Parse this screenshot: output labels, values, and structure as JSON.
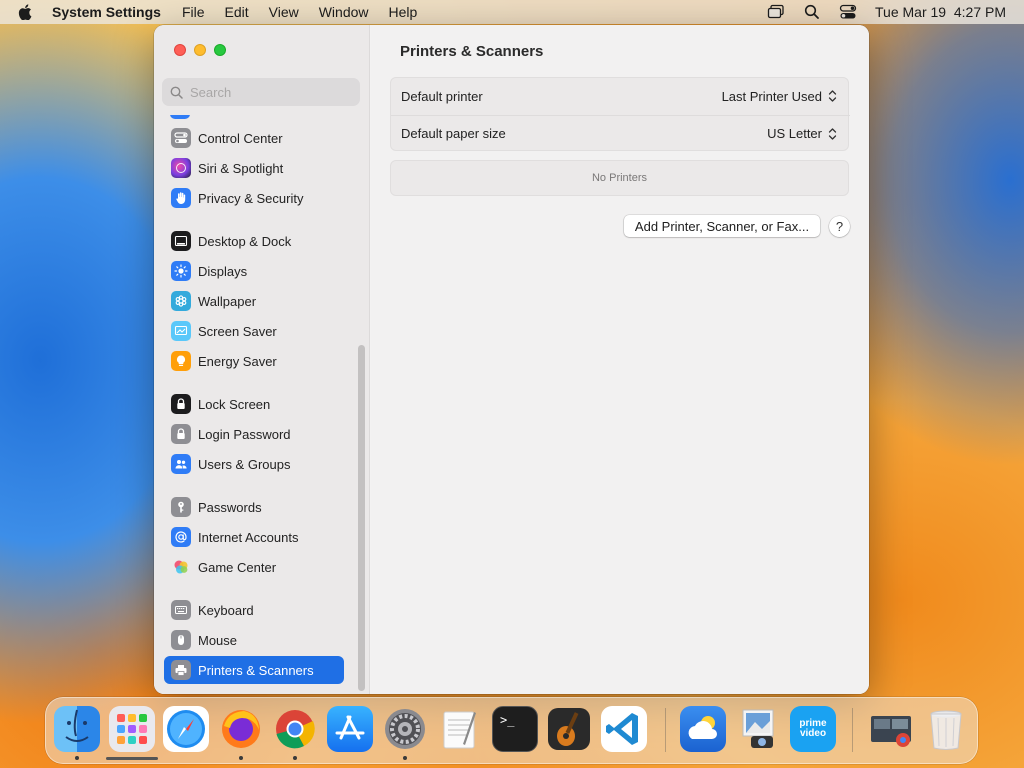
{
  "menubar": {
    "app_name": "System Settings",
    "menus": [
      "File",
      "Edit",
      "View",
      "Window",
      "Help"
    ],
    "clock": "Tue Mar 19  4:27 PM"
  },
  "sidebar": {
    "search_placeholder": "Search",
    "items": [
      {
        "label": "Control Center",
        "icon": "control-center-icon",
        "color": "#8e8e93"
      },
      {
        "label": "Siri & Spotlight",
        "icon": "siri-icon",
        "color": "#7a3fe0"
      },
      {
        "label": "Privacy & Security",
        "icon": "hand-icon",
        "color": "#2f7cf6"
      },
      {
        "label": "Desktop & Dock",
        "icon": "dock-icon",
        "color": "#1c1c1e"
      },
      {
        "label": "Displays",
        "icon": "sun-icon",
        "color": "#2f7cf6"
      },
      {
        "label": "Wallpaper",
        "icon": "wallpaper-icon",
        "color": "#34aadc"
      },
      {
        "label": "Screen Saver",
        "icon": "screen-saver-icon",
        "color": "#5ac8fa"
      },
      {
        "label": "Energy Saver",
        "icon": "bulb-icon",
        "color": "#ff9f0a"
      },
      {
        "label": "Lock Screen",
        "icon": "lock-icon",
        "color": "#1c1c1e"
      },
      {
        "label": "Login Password",
        "icon": "lock-icon",
        "color": "#8e8e93"
      },
      {
        "label": "Users & Groups",
        "icon": "users-icon",
        "color": "#2f7cf6"
      },
      {
        "label": "Passwords",
        "icon": "key-icon",
        "color": "#8e8e93"
      },
      {
        "label": "Internet Accounts",
        "icon": "at-icon",
        "color": "#2f7cf6"
      },
      {
        "label": "Game Center",
        "icon": "game-center-icon",
        "color": "#ffffff"
      },
      {
        "label": "Keyboard",
        "icon": "keyboard-icon",
        "color": "#8e8e93"
      },
      {
        "label": "Mouse",
        "icon": "mouse-icon",
        "color": "#8e8e93"
      },
      {
        "label": "Printers & Scanners",
        "icon": "printer-icon",
        "color": "#8e8e93"
      }
    ]
  },
  "main": {
    "title": "Printers & Scanners",
    "default_printer_label": "Default printer",
    "default_printer_value": "Last Printer Used",
    "default_paper_label": "Default paper size",
    "default_paper_value": "US Letter",
    "no_printers": "No Printers",
    "add_button": "Add Printer, Scanner, or Fax...",
    "help_button": "?"
  },
  "dock": {
    "apps": [
      "finder-icon",
      "launchpad-icon",
      "safari-icon",
      "firefox-icon",
      "chrome-icon",
      "app-store-icon",
      "system-settings-icon",
      "textedit-icon",
      "terminal-icon",
      "garageband-icon",
      "vscode-icon",
      "weather-icon",
      "preview-icon",
      "prime-video-icon",
      "downloads-stack-icon",
      "trash-icon"
    ],
    "prime_video_label": "prime video",
    "terminal_label": ">_"
  }
}
